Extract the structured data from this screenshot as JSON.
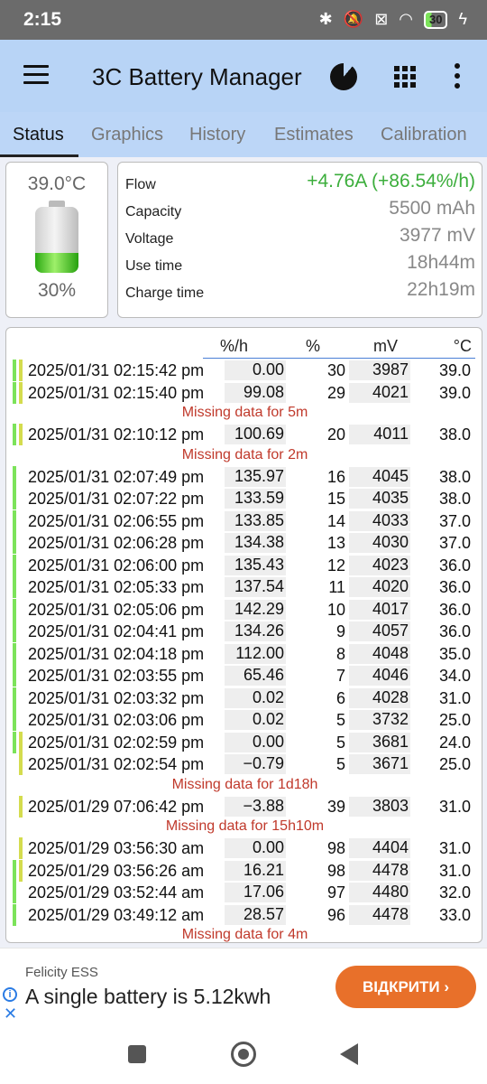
{
  "status_bar": {
    "time": "2:15",
    "battery": "30"
  },
  "app": {
    "title": "3C Battery Manager"
  },
  "tabs": [
    {
      "label": "Status"
    },
    {
      "label": "Graphics"
    },
    {
      "label": "History"
    },
    {
      "label": "Estimates"
    },
    {
      "label": "Calibration"
    }
  ],
  "battery_card": {
    "temperature": "39.0°C",
    "percent": "30%",
    "level": 30
  },
  "info": [
    {
      "label": "Flow",
      "value": "+4.76A (+86.54%/h)"
    },
    {
      "label": "Capacity",
      "value": "5500 mAh"
    },
    {
      "label": "Voltage",
      "value": "3977 mV"
    },
    {
      "label": "Use time",
      "value": "18h44m"
    },
    {
      "label": "Charge time",
      "value": "22h19m"
    }
  ],
  "history": {
    "headers": {
      "rate": "%/h",
      "pct": "%",
      "mv": "mV",
      "temp": "°C"
    },
    "rows": [
      {
        "date": "2025/01/31  02:15:42 pm",
        "rate": "0.00",
        "pct": "30",
        "mv": "3987",
        "temp": "39.0"
      },
      {
        "date": "2025/01/31  02:15:40 pm",
        "rate": "99.08",
        "pct": "29",
        "mv": "4021",
        "temp": "39.0"
      },
      {
        "gap": "Missing data for 5m"
      },
      {
        "date": "2025/01/31  02:10:12 pm",
        "rate": "100.69",
        "pct": "20",
        "mv": "4011",
        "temp": "38.0"
      },
      {
        "gap": "Missing data for 2m"
      },
      {
        "date": "2025/01/31  02:07:49 pm",
        "rate": "135.97",
        "pct": "16",
        "mv": "4045",
        "temp": "38.0"
      },
      {
        "date": "2025/01/31  02:07:22 pm",
        "rate": "133.59",
        "pct": "15",
        "mv": "4035",
        "temp": "38.0"
      },
      {
        "date": "2025/01/31  02:06:55 pm",
        "rate": "133.85",
        "pct": "14",
        "mv": "4033",
        "temp": "37.0"
      },
      {
        "date": "2025/01/31  02:06:28 pm",
        "rate": "134.38",
        "pct": "13",
        "mv": "4030",
        "temp": "37.0"
      },
      {
        "date": "2025/01/31  02:06:00 pm",
        "rate": "135.43",
        "pct": "12",
        "mv": "4023",
        "temp": "36.0"
      },
      {
        "date": "2025/01/31  02:05:33 pm",
        "rate": "137.54",
        "pct": "11",
        "mv": "4020",
        "temp": "36.0"
      },
      {
        "date": "2025/01/31  02:05:06 pm",
        "rate": "142.29",
        "pct": "10",
        "mv": "4017",
        "temp": "36.0"
      },
      {
        "date": "2025/01/31  02:04:41 pm",
        "rate": "134.26",
        "pct": "9",
        "mv": "4057",
        "temp": "36.0"
      },
      {
        "date": "2025/01/31  02:04:18 pm",
        "rate": "112.00",
        "pct": "8",
        "mv": "4048",
        "temp": "35.0"
      },
      {
        "date": "2025/01/31  02:03:55 pm",
        "rate": "65.46",
        "pct": "7",
        "mv": "4046",
        "temp": "34.0"
      },
      {
        "date": "2025/01/31  02:03:32 pm",
        "rate": "0.02",
        "pct": "6",
        "mv": "4028",
        "temp": "31.0"
      },
      {
        "date": "2025/01/31  02:03:06 pm",
        "rate": "0.02",
        "pct": "5",
        "mv": "3732",
        "temp": "25.0"
      },
      {
        "date": "2025/01/31  02:02:59 pm",
        "rate": "0.00",
        "pct": "5",
        "mv": "3681",
        "temp": "24.0"
      },
      {
        "date": "2025/01/31  02:02:54 pm",
        "rate": "−0.79",
        "pct": "5",
        "mv": "3671",
        "temp": "25.0"
      },
      {
        "gap": "Missing data for 1d18h"
      },
      {
        "date": "2025/01/29  07:06:42 pm",
        "rate": "−3.88",
        "pct": "39",
        "mv": "3803",
        "temp": "31.0"
      },
      {
        "gap": "Missing data for 15h10m"
      },
      {
        "date": "2025/01/29  03:56:30 am",
        "rate": "0.00",
        "pct": "98",
        "mv": "4404",
        "temp": "31.0"
      },
      {
        "date": "2025/01/29  03:56:26 am",
        "rate": "16.21",
        "pct": "98",
        "mv": "4478",
        "temp": "31.0"
      },
      {
        "date": "2025/01/29  03:52:44 am",
        "rate": "17.06",
        "pct": "97",
        "mv": "4480",
        "temp": "32.0"
      },
      {
        "date": "2025/01/29  03:49:12 am",
        "rate": "28.57",
        "pct": "96",
        "mv": "4478",
        "temp": "33.0"
      },
      {
        "gap": "Missing data for 4m"
      }
    ]
  },
  "ad": {
    "brand": "Felicity ESS",
    "text": "A single battery is 5.12kwh",
    "cta": "ВІДКРИТИ ›"
  },
  "colors": {
    "flow_green": "#3cae3c",
    "charge_bar": "#7ce35a",
    "idle_bar": "#d4dc4e",
    "gap_red": "#c0392b",
    "cta_orange": "#e8702a",
    "appbar": "#b8d4f6"
  },
  "icons": [
    "menu-icon",
    "pie-chart-icon",
    "grid-icon",
    "more-vert-icon",
    "battery-icon",
    "info-icon",
    "close-icon"
  ]
}
